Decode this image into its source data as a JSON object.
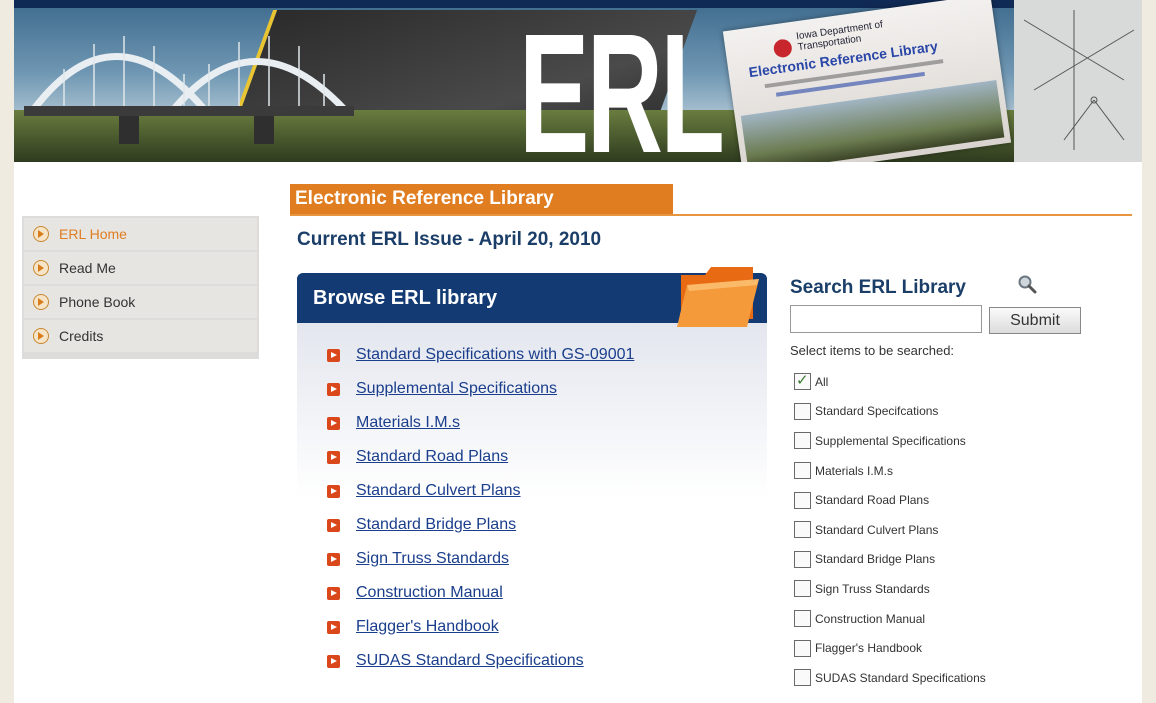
{
  "banner": {
    "logo_text": "ERL",
    "card_department": "Iowa Department of Transportation",
    "card_title": "Electronic Reference Library"
  },
  "sidebar": {
    "items": [
      {
        "label": "ERL Home",
        "active": true
      },
      {
        "label": "Read Me"
      },
      {
        "label": "Phone Book"
      },
      {
        "label": "Credits"
      }
    ]
  },
  "main": {
    "section_title": "Electronic Reference Library",
    "issue": "Current ERL Issue - April 20, 2010",
    "browse": {
      "title": "Browse ERL library",
      "links": [
        "Standard Specifications with GS-09001",
        "Supplemental Specifications",
        "Materials I.M.s",
        "Standard Road Plans",
        "Standard Culvert Plans",
        "Standard Bridge Plans",
        "Sign Truss Standards",
        "Construction Manual",
        "Flagger's Handbook",
        "SUDAS Standard Specifications"
      ]
    }
  },
  "search": {
    "title": "Search ERL Library",
    "input_value": "",
    "submit_label": "Submit",
    "select_label": "Select items to be searched:",
    "options": [
      {
        "label": "All",
        "checked": true
      },
      {
        "label": "Standard Specifcations",
        "checked": false
      },
      {
        "label": "Supplemental Specifications",
        "checked": false
      },
      {
        "label": "Materials I.M.s",
        "checked": false
      },
      {
        "label": "Standard Road Plans",
        "checked": false
      },
      {
        "label": "Standard Culvert Plans",
        "checked": false
      },
      {
        "label": "Standard Bridge Plans",
        "checked": false
      },
      {
        "label": "Sign Truss Standards",
        "checked": false
      },
      {
        "label": "Construction Manual",
        "checked": false
      },
      {
        "label": "Flagger's Handbook",
        "checked": false
      },
      {
        "label": "SUDAS Standard Specifications",
        "checked": false
      }
    ]
  },
  "colors": {
    "accent": "#e07d21",
    "navy": "#133a73",
    "link": "#1a3e8c"
  }
}
